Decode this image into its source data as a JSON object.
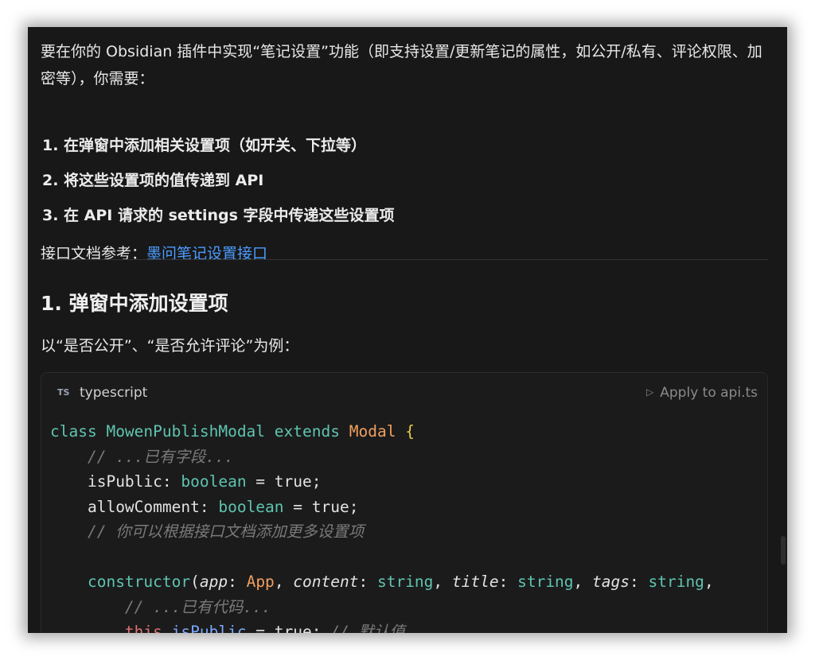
{
  "intro": "要在你的 Obsidian 插件中实现“笔记设置”功能（即支持设置/更新笔记的属性，如公开/私有、评论权限、加密等），你需要：",
  "steps": [
    "1. 在弹窗中添加相关设置项（如开关、下拉等）",
    "2. 将这些设置项的值传递到 API",
    "3. 在 API 请求的 settings 字段中传递这些设置项"
  ],
  "reference": {
    "prefix": "接口文档参考：",
    "link_text": "墨问笔记设置接口"
  },
  "section": {
    "heading": "1. 弹窗中添加设置项",
    "subtext": "以“是否公开”、“是否允许评论”为例："
  },
  "code_block": {
    "badge": "TS",
    "language": "typescript",
    "apply_label": "Apply to api.ts",
    "lines": {
      "l1_kw": "class",
      "l1_name": "MowenPublishModal",
      "l1_ext": "extends",
      "l1_base": "Modal",
      "l1_brace": "{",
      "l2": "// ...已有字段...",
      "l3_name": "isPublic",
      "l3_type": "boolean",
      "l3_val": "true",
      "l4_name": "allowComment",
      "l4_type": "boolean",
      "l4_val": "true",
      "l5": "// 你可以根据接口文档添加更多设置项",
      "l7_fn": "constructor",
      "l7_p1": "app",
      "l7_t1": "App",
      "l7_p2": "content",
      "l7_t2": "string",
      "l7_p3": "title",
      "l7_t3": "string",
      "l7_p4": "tags",
      "l7_t4": "string",
      "l8": "// ...已有代码...",
      "l9_this": "this",
      "l9_prop": "isPublic",
      "l9_val": "true",
      "l9_cmt": "// 默认值"
    }
  }
}
